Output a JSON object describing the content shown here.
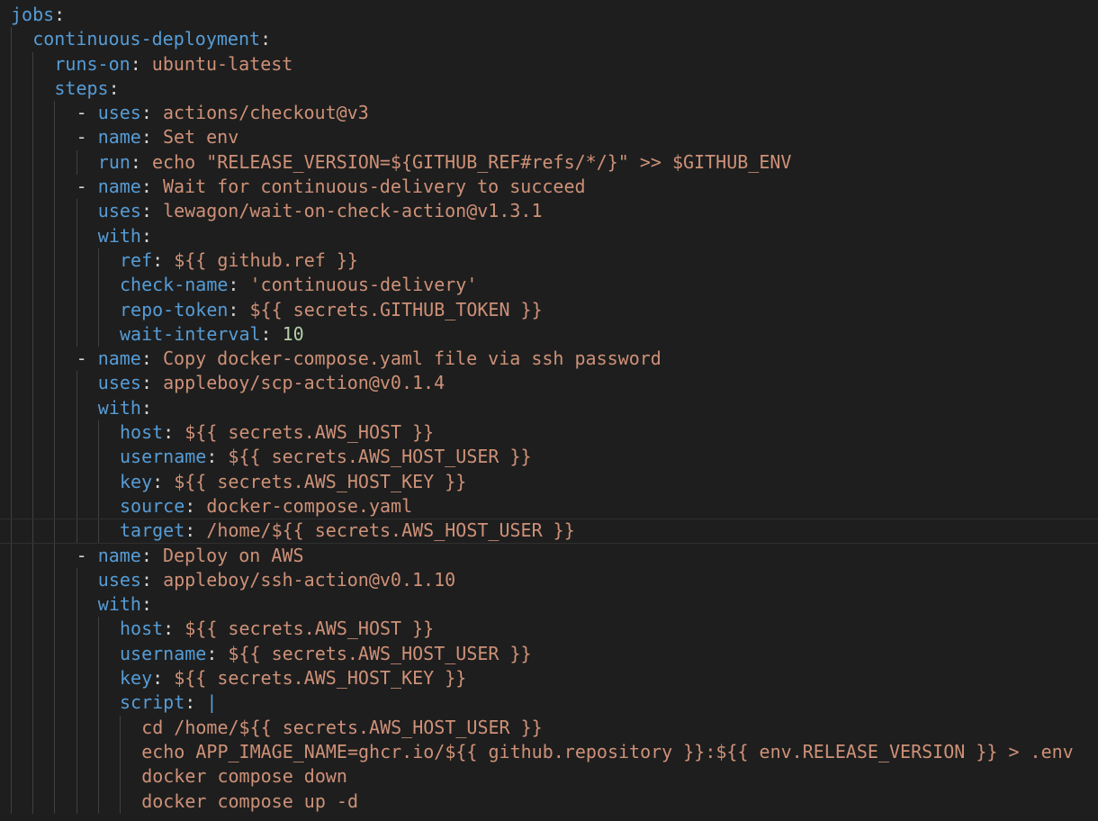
{
  "editor": {
    "language": "yaml",
    "lines": [
      {
        "indent": 0,
        "tokens": [
          {
            "t": "k",
            "v": "jobs"
          },
          {
            "t": "p",
            "v": ":"
          }
        ]
      },
      {
        "indent": 1,
        "tokens": [
          {
            "t": "k",
            "v": "continuous-deployment"
          },
          {
            "t": "p",
            "v": ":"
          }
        ]
      },
      {
        "indent": 2,
        "tokens": [
          {
            "t": "k",
            "v": "runs-on"
          },
          {
            "t": "p",
            "v": ": "
          },
          {
            "t": "s",
            "v": "ubuntu-latest"
          }
        ]
      },
      {
        "indent": 2,
        "tokens": [
          {
            "t": "k",
            "v": "steps"
          },
          {
            "t": "p",
            "v": ":"
          }
        ]
      },
      {
        "indent": 3,
        "tokens": [
          {
            "t": "p",
            "v": "- "
          },
          {
            "t": "k",
            "v": "uses"
          },
          {
            "t": "p",
            "v": ": "
          },
          {
            "t": "s",
            "v": "actions/checkout@v3"
          }
        ]
      },
      {
        "indent": 3,
        "tokens": [
          {
            "t": "p",
            "v": "- "
          },
          {
            "t": "k",
            "v": "name"
          },
          {
            "t": "p",
            "v": ": "
          },
          {
            "t": "s",
            "v": "Set env"
          }
        ]
      },
      {
        "indent": 4,
        "tokens": [
          {
            "t": "k",
            "v": "run"
          },
          {
            "t": "p",
            "v": ": "
          },
          {
            "t": "s",
            "v": "echo \"RELEASE_VERSION=${GITHUB_REF#refs/*/}\" >> $GITHUB_ENV"
          }
        ]
      },
      {
        "indent": 3,
        "tokens": [
          {
            "t": "p",
            "v": "- "
          },
          {
            "t": "k",
            "v": "name"
          },
          {
            "t": "p",
            "v": ": "
          },
          {
            "t": "s",
            "v": "Wait for continuous-delivery to succeed"
          }
        ]
      },
      {
        "indent": 4,
        "tokens": [
          {
            "t": "k",
            "v": "uses"
          },
          {
            "t": "p",
            "v": ": "
          },
          {
            "t": "s",
            "v": "lewagon/wait-on-check-action@v1.3.1"
          }
        ]
      },
      {
        "indent": 4,
        "tokens": [
          {
            "t": "k",
            "v": "with"
          },
          {
            "t": "p",
            "v": ":"
          }
        ]
      },
      {
        "indent": 5,
        "tokens": [
          {
            "t": "k",
            "v": "ref"
          },
          {
            "t": "p",
            "v": ": "
          },
          {
            "t": "s",
            "v": "${{ github.ref }}"
          }
        ]
      },
      {
        "indent": 5,
        "tokens": [
          {
            "t": "k",
            "v": "check-name"
          },
          {
            "t": "p",
            "v": ": "
          },
          {
            "t": "s",
            "v": "'continuous-delivery'"
          }
        ]
      },
      {
        "indent": 5,
        "tokens": [
          {
            "t": "k",
            "v": "repo-token"
          },
          {
            "t": "p",
            "v": ": "
          },
          {
            "t": "s",
            "v": "${{ secrets.GITHUB_TOKEN }}"
          }
        ]
      },
      {
        "indent": 5,
        "tokens": [
          {
            "t": "k",
            "v": "wait-interval"
          },
          {
            "t": "p",
            "v": ": "
          },
          {
            "t": "n",
            "v": "10"
          }
        ]
      },
      {
        "indent": 3,
        "tokens": [
          {
            "t": "p",
            "v": "- "
          },
          {
            "t": "k",
            "v": "name"
          },
          {
            "t": "p",
            "v": ": "
          },
          {
            "t": "s",
            "v": "Copy docker-compose.yaml file via ssh password"
          }
        ]
      },
      {
        "indent": 4,
        "tokens": [
          {
            "t": "k",
            "v": "uses"
          },
          {
            "t": "p",
            "v": ": "
          },
          {
            "t": "s",
            "v": "appleboy/scp-action@v0.1.4"
          }
        ]
      },
      {
        "indent": 4,
        "tokens": [
          {
            "t": "k",
            "v": "with"
          },
          {
            "t": "p",
            "v": ":"
          }
        ]
      },
      {
        "indent": 5,
        "tokens": [
          {
            "t": "k",
            "v": "host"
          },
          {
            "t": "p",
            "v": ": "
          },
          {
            "t": "s",
            "v": "${{ secrets.AWS_HOST }}"
          }
        ]
      },
      {
        "indent": 5,
        "tokens": [
          {
            "t": "k",
            "v": "username"
          },
          {
            "t": "p",
            "v": ": "
          },
          {
            "t": "s",
            "v": "${{ secrets.AWS_HOST_USER }}"
          }
        ]
      },
      {
        "indent": 5,
        "tokens": [
          {
            "t": "k",
            "v": "key"
          },
          {
            "t": "p",
            "v": ": "
          },
          {
            "t": "s",
            "v": "${{ secrets.AWS_HOST_KEY }}"
          }
        ]
      },
      {
        "indent": 5,
        "tokens": [
          {
            "t": "k",
            "v": "source"
          },
          {
            "t": "p",
            "v": ": "
          },
          {
            "t": "s",
            "v": "docker-compose.yaml"
          }
        ]
      },
      {
        "indent": 5,
        "current": true,
        "tokens": [
          {
            "t": "k",
            "v": "target"
          },
          {
            "t": "p",
            "v": ": "
          },
          {
            "t": "s",
            "v": "/home/${{ secrets.AWS_HOST_USER }}"
          }
        ]
      },
      {
        "indent": 3,
        "tokens": [
          {
            "t": "p",
            "v": "- "
          },
          {
            "t": "k",
            "v": "name"
          },
          {
            "t": "p",
            "v": ": "
          },
          {
            "t": "s",
            "v": "Deploy on AWS"
          }
        ]
      },
      {
        "indent": 4,
        "tokens": [
          {
            "t": "k",
            "v": "uses"
          },
          {
            "t": "p",
            "v": ": "
          },
          {
            "t": "s",
            "v": "appleboy/ssh-action@v0.1.10"
          }
        ]
      },
      {
        "indent": 4,
        "tokens": [
          {
            "t": "k",
            "v": "with"
          },
          {
            "t": "p",
            "v": ":"
          }
        ]
      },
      {
        "indent": 5,
        "tokens": [
          {
            "t": "k",
            "v": "host"
          },
          {
            "t": "p",
            "v": ": "
          },
          {
            "t": "s",
            "v": "${{ secrets.AWS_HOST }}"
          }
        ]
      },
      {
        "indent": 5,
        "tokens": [
          {
            "t": "k",
            "v": "username"
          },
          {
            "t": "p",
            "v": ": "
          },
          {
            "t": "s",
            "v": "${{ secrets.AWS_HOST_USER }}"
          }
        ]
      },
      {
        "indent": 5,
        "tokens": [
          {
            "t": "k",
            "v": "key"
          },
          {
            "t": "p",
            "v": ": "
          },
          {
            "t": "s",
            "v": "${{ secrets.AWS_HOST_KEY }}"
          }
        ]
      },
      {
        "indent": 5,
        "tokens": [
          {
            "t": "k",
            "v": "script"
          },
          {
            "t": "p",
            "v": ": "
          },
          {
            "t": "k",
            "v": "|"
          }
        ]
      },
      {
        "indent": 6,
        "tokens": [
          {
            "t": "s",
            "v": "cd /home/${{ secrets.AWS_HOST_USER }}"
          }
        ]
      },
      {
        "indent": 6,
        "tokens": [
          {
            "t": "s",
            "v": "echo APP_IMAGE_NAME=ghcr.io/${{ github.repository }}:${{ env.RELEASE_VERSION }} > .env"
          }
        ]
      },
      {
        "indent": 6,
        "tokens": [
          {
            "t": "s",
            "v": "docker compose down"
          }
        ]
      },
      {
        "indent": 6,
        "tokens": [
          {
            "t": "s",
            "v": "docker compose up -d"
          }
        ]
      }
    ]
  }
}
